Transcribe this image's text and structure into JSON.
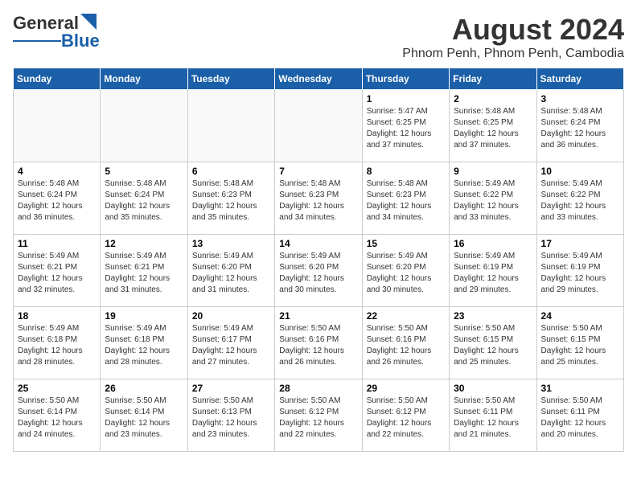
{
  "logo": {
    "line1": "General",
    "line2": "Blue"
  },
  "title": {
    "month": "August 2024",
    "location": "Phnom Penh, Phnom Penh, Cambodia"
  },
  "weekdays": [
    "Sunday",
    "Monday",
    "Tuesday",
    "Wednesday",
    "Thursday",
    "Friday",
    "Saturday"
  ],
  "weeks": [
    [
      {
        "day": "",
        "info": ""
      },
      {
        "day": "",
        "info": ""
      },
      {
        "day": "",
        "info": ""
      },
      {
        "day": "",
        "info": ""
      },
      {
        "day": "1",
        "info": "Sunrise: 5:47 AM\nSunset: 6:25 PM\nDaylight: 12 hours\nand 37 minutes."
      },
      {
        "day": "2",
        "info": "Sunrise: 5:48 AM\nSunset: 6:25 PM\nDaylight: 12 hours\nand 37 minutes."
      },
      {
        "day": "3",
        "info": "Sunrise: 5:48 AM\nSunset: 6:24 PM\nDaylight: 12 hours\nand 36 minutes."
      }
    ],
    [
      {
        "day": "4",
        "info": "Sunrise: 5:48 AM\nSunset: 6:24 PM\nDaylight: 12 hours\nand 36 minutes."
      },
      {
        "day": "5",
        "info": "Sunrise: 5:48 AM\nSunset: 6:24 PM\nDaylight: 12 hours\nand 35 minutes."
      },
      {
        "day": "6",
        "info": "Sunrise: 5:48 AM\nSunset: 6:23 PM\nDaylight: 12 hours\nand 35 minutes."
      },
      {
        "day": "7",
        "info": "Sunrise: 5:48 AM\nSunset: 6:23 PM\nDaylight: 12 hours\nand 34 minutes."
      },
      {
        "day": "8",
        "info": "Sunrise: 5:48 AM\nSunset: 6:23 PM\nDaylight: 12 hours\nand 34 minutes."
      },
      {
        "day": "9",
        "info": "Sunrise: 5:49 AM\nSunset: 6:22 PM\nDaylight: 12 hours\nand 33 minutes."
      },
      {
        "day": "10",
        "info": "Sunrise: 5:49 AM\nSunset: 6:22 PM\nDaylight: 12 hours\nand 33 minutes."
      }
    ],
    [
      {
        "day": "11",
        "info": "Sunrise: 5:49 AM\nSunset: 6:21 PM\nDaylight: 12 hours\nand 32 minutes."
      },
      {
        "day": "12",
        "info": "Sunrise: 5:49 AM\nSunset: 6:21 PM\nDaylight: 12 hours\nand 31 minutes."
      },
      {
        "day": "13",
        "info": "Sunrise: 5:49 AM\nSunset: 6:20 PM\nDaylight: 12 hours\nand 31 minutes."
      },
      {
        "day": "14",
        "info": "Sunrise: 5:49 AM\nSunset: 6:20 PM\nDaylight: 12 hours\nand 30 minutes."
      },
      {
        "day": "15",
        "info": "Sunrise: 5:49 AM\nSunset: 6:20 PM\nDaylight: 12 hours\nand 30 minutes."
      },
      {
        "day": "16",
        "info": "Sunrise: 5:49 AM\nSunset: 6:19 PM\nDaylight: 12 hours\nand 29 minutes."
      },
      {
        "day": "17",
        "info": "Sunrise: 5:49 AM\nSunset: 6:19 PM\nDaylight: 12 hours\nand 29 minutes."
      }
    ],
    [
      {
        "day": "18",
        "info": "Sunrise: 5:49 AM\nSunset: 6:18 PM\nDaylight: 12 hours\nand 28 minutes."
      },
      {
        "day": "19",
        "info": "Sunrise: 5:49 AM\nSunset: 6:18 PM\nDaylight: 12 hours\nand 28 minutes."
      },
      {
        "day": "20",
        "info": "Sunrise: 5:49 AM\nSunset: 6:17 PM\nDaylight: 12 hours\nand 27 minutes."
      },
      {
        "day": "21",
        "info": "Sunrise: 5:50 AM\nSunset: 6:16 PM\nDaylight: 12 hours\nand 26 minutes."
      },
      {
        "day": "22",
        "info": "Sunrise: 5:50 AM\nSunset: 6:16 PM\nDaylight: 12 hours\nand 26 minutes."
      },
      {
        "day": "23",
        "info": "Sunrise: 5:50 AM\nSunset: 6:15 PM\nDaylight: 12 hours\nand 25 minutes."
      },
      {
        "day": "24",
        "info": "Sunrise: 5:50 AM\nSunset: 6:15 PM\nDaylight: 12 hours\nand 25 minutes."
      }
    ],
    [
      {
        "day": "25",
        "info": "Sunrise: 5:50 AM\nSunset: 6:14 PM\nDaylight: 12 hours\nand 24 minutes."
      },
      {
        "day": "26",
        "info": "Sunrise: 5:50 AM\nSunset: 6:14 PM\nDaylight: 12 hours\nand 23 minutes."
      },
      {
        "day": "27",
        "info": "Sunrise: 5:50 AM\nSunset: 6:13 PM\nDaylight: 12 hours\nand 23 minutes."
      },
      {
        "day": "28",
        "info": "Sunrise: 5:50 AM\nSunset: 6:12 PM\nDaylight: 12 hours\nand 22 minutes."
      },
      {
        "day": "29",
        "info": "Sunrise: 5:50 AM\nSunset: 6:12 PM\nDaylight: 12 hours\nand 22 minutes."
      },
      {
        "day": "30",
        "info": "Sunrise: 5:50 AM\nSunset: 6:11 PM\nDaylight: 12 hours\nand 21 minutes."
      },
      {
        "day": "31",
        "info": "Sunrise: 5:50 AM\nSunset: 6:11 PM\nDaylight: 12 hours\nand 20 minutes."
      }
    ]
  ]
}
